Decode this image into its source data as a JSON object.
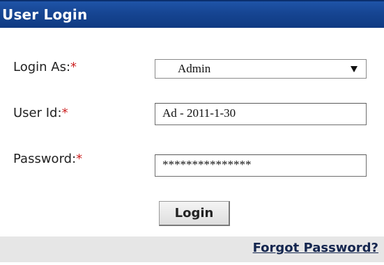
{
  "panel": {
    "title": "User Login"
  },
  "form": {
    "login_as": {
      "label": "Login As:",
      "required_mark": "*",
      "selected_value": "Admin"
    },
    "user_id": {
      "label": "User Id:",
      "required_mark": "*",
      "value": "Ad - 2011-1-30"
    },
    "password": {
      "label": "Password:",
      "required_mark": "*",
      "masked_value": "***************"
    },
    "login_button_label": "Login"
  },
  "footer": {
    "forgot_password_link": "Forgot Password?"
  },
  "colors": {
    "header_bg": "#164592",
    "required_mark": "#cc2222",
    "footer_bg": "#e6e6e6",
    "link": "#14264f"
  },
  "icons": {
    "dropdown": "chevron-down-icon"
  }
}
